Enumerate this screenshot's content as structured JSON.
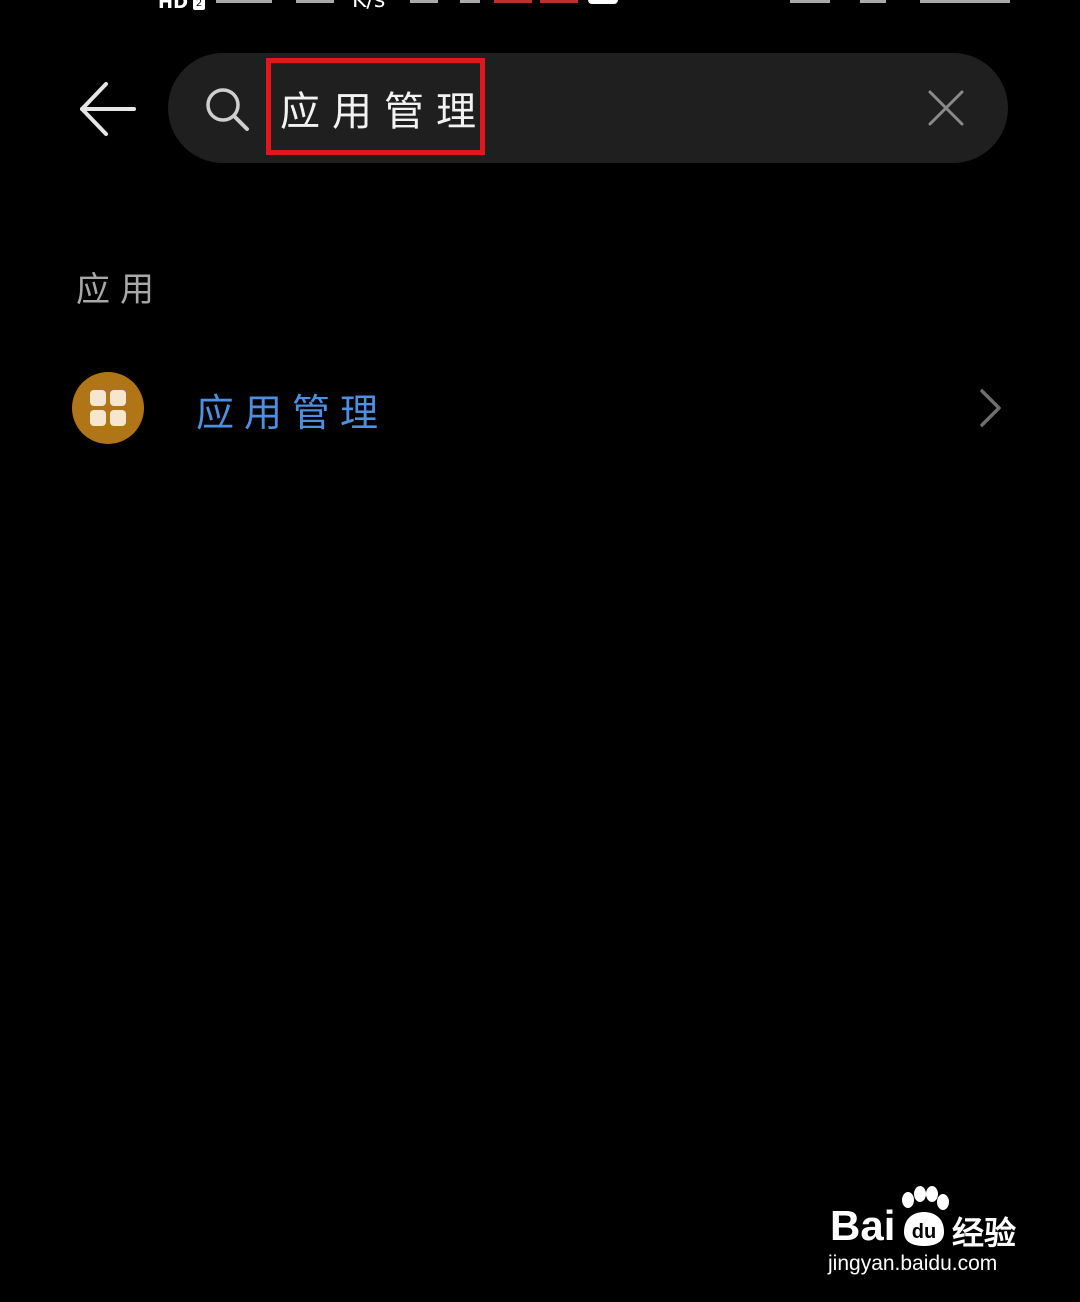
{
  "status_bar": {
    "hd_label": "HD",
    "hd_sub": "2",
    "speed_label": "K/s"
  },
  "header": {
    "back_icon": "arrow-left-icon",
    "search": {
      "icon": "search-icon",
      "value": "应用管理",
      "clear_icon": "close-icon"
    }
  },
  "annotation": {
    "color": "#e3161e"
  },
  "results": {
    "section_title": "应用",
    "items": [
      {
        "label": "应用管理",
        "icon": "app-grid-icon",
        "icon_color": "#b07516",
        "label_color": "#4d8fe0",
        "trailing_icon": "chevron-right-icon"
      }
    ]
  },
  "watermark": {
    "brand": "Bai",
    "brand_suffix": "经验",
    "url": "jingyan.baidu.com"
  }
}
